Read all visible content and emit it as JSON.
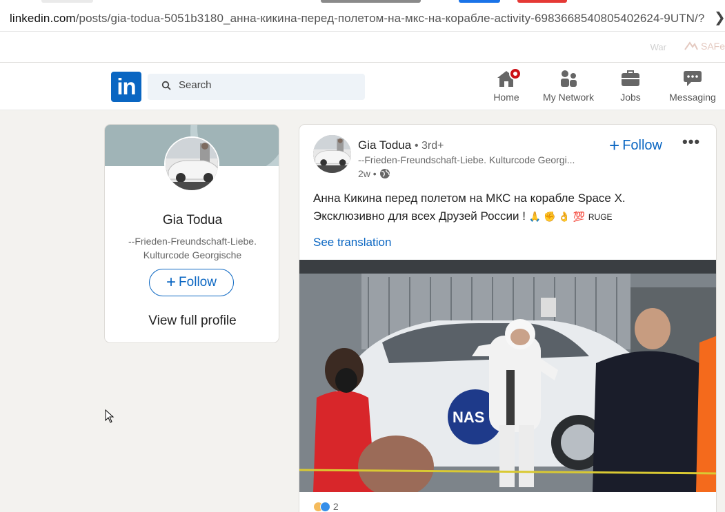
{
  "browser": {
    "url_host": "linkedin.com",
    "url_path": "/posts/gia-todua-5051b3180_анна-кикина-перед-полетом-на-мкс-на-корабле-activity-6983668540805402624-9UTN/?",
    "bookmark_war": "War",
    "bookmark_safe": "SAFe"
  },
  "nav": {
    "search_placeholder": "Search",
    "items": [
      {
        "label": "Home",
        "icon": "home-icon"
      },
      {
        "label": "My Network",
        "icon": "people-icon"
      },
      {
        "label": "Jobs",
        "icon": "briefcase-icon"
      },
      {
        "label": "Messaging",
        "icon": "chat-bubble-icon"
      }
    ],
    "colors": {
      "brand": "#0a66c2",
      "badge": "#cc1016"
    }
  },
  "profile_card": {
    "name": "Gia Todua",
    "headline": "--Frieden-Freundschaft-Liebe. Kulturcode Georgische",
    "follow_label": "Follow",
    "view_profile_label": "View full profile"
  },
  "post": {
    "author": "Gia Todua",
    "degree": "• 3rd+",
    "headline": "--Frieden-Freundschaft-Liebe. Kulturcode Georgi...",
    "time": "2w •",
    "follow_label": "Follow",
    "more_label": "•••",
    "text_line1": "Анна Кикина перед полетом на МКС на корабле Space X.",
    "text_line2": "Эксклюзивно для всех Друзей России !",
    "text_emojis": "🙏 ✊ 👌 💯",
    "text_tail": "RUGE",
    "see_translation": "See translation",
    "reaction_count": "2"
  }
}
